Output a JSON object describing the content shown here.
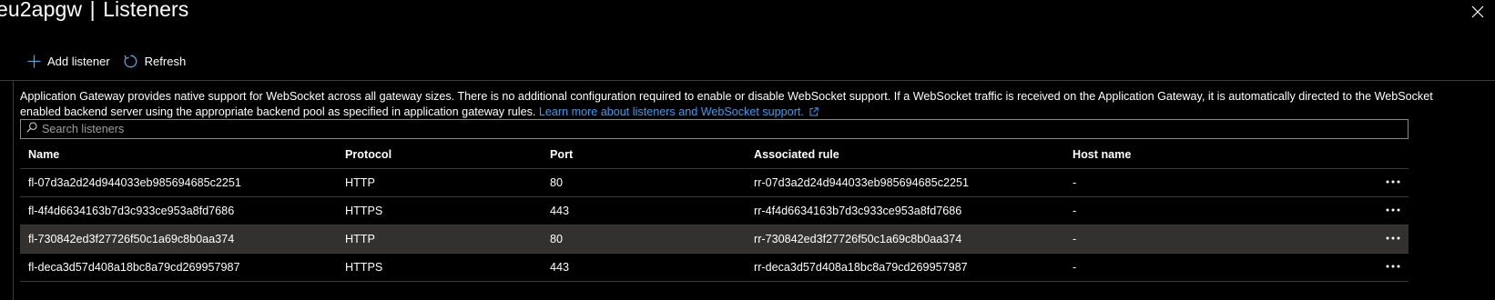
{
  "header": {
    "title_prefix": "eu2apgw",
    "separator": "|",
    "title": "Listeners"
  },
  "icons": {
    "close": "close-icon",
    "add": "add-icon",
    "refresh": "refresh-icon",
    "search": "search-icon",
    "external_link": "external-link-icon",
    "more": "more-options-icon"
  },
  "toolbar": {
    "add_label": "Add listener",
    "refresh_label": "Refresh"
  },
  "info": {
    "text": "Application Gateway provides native support for WebSocket across all gateway sizes. There is no additional configuration required to enable or disable WebSocket support. If a WebSocket traffic is received on the Application Gateway, it is automatically directed to the WebSocket enabled backend server using the appropriate backend pool as specified in application gateway rules.",
    "link_text": "Learn more about listeners and WebSocket support."
  },
  "search": {
    "placeholder": "Search listeners",
    "value": ""
  },
  "table": {
    "columns": [
      "Name",
      "Protocol",
      "Port",
      "Associated rule",
      "Host name"
    ],
    "rows": [
      {
        "name": "fl-07d3a2d24d944033eb985694685c2251",
        "protocol": "HTTP",
        "port": "80",
        "rule": "rr-07d3a2d24d944033eb985694685c2251",
        "host": "-"
      },
      {
        "name": "fl-4f4d6634163b7d3c933ce953a8fd7686",
        "protocol": "HTTPS",
        "port": "443",
        "rule": "rr-4f4d6634163b7d3c933ce953a8fd7686",
        "host": "-"
      },
      {
        "name": "fl-730842ed3f27726f50c1a69c8b0aa374",
        "protocol": "HTTP",
        "port": "80",
        "rule": "rr-730842ed3f27726f50c1a69c8b0aa374",
        "host": "-"
      },
      {
        "name": "fl-deca3d57d408a18bc8a79cd269957987",
        "protocol": "HTTPS",
        "port": "443",
        "rule": "rr-deca3d57d408a18bc8a79cd269957987",
        "host": "-"
      }
    ],
    "selected_row": 2
  },
  "colors": {
    "background": "#000000",
    "text": "#ffffff",
    "link": "#3b9ced",
    "accent_icon": "#4fa3ea",
    "selected_row": "#323130",
    "divider": "#3b3a39"
  }
}
